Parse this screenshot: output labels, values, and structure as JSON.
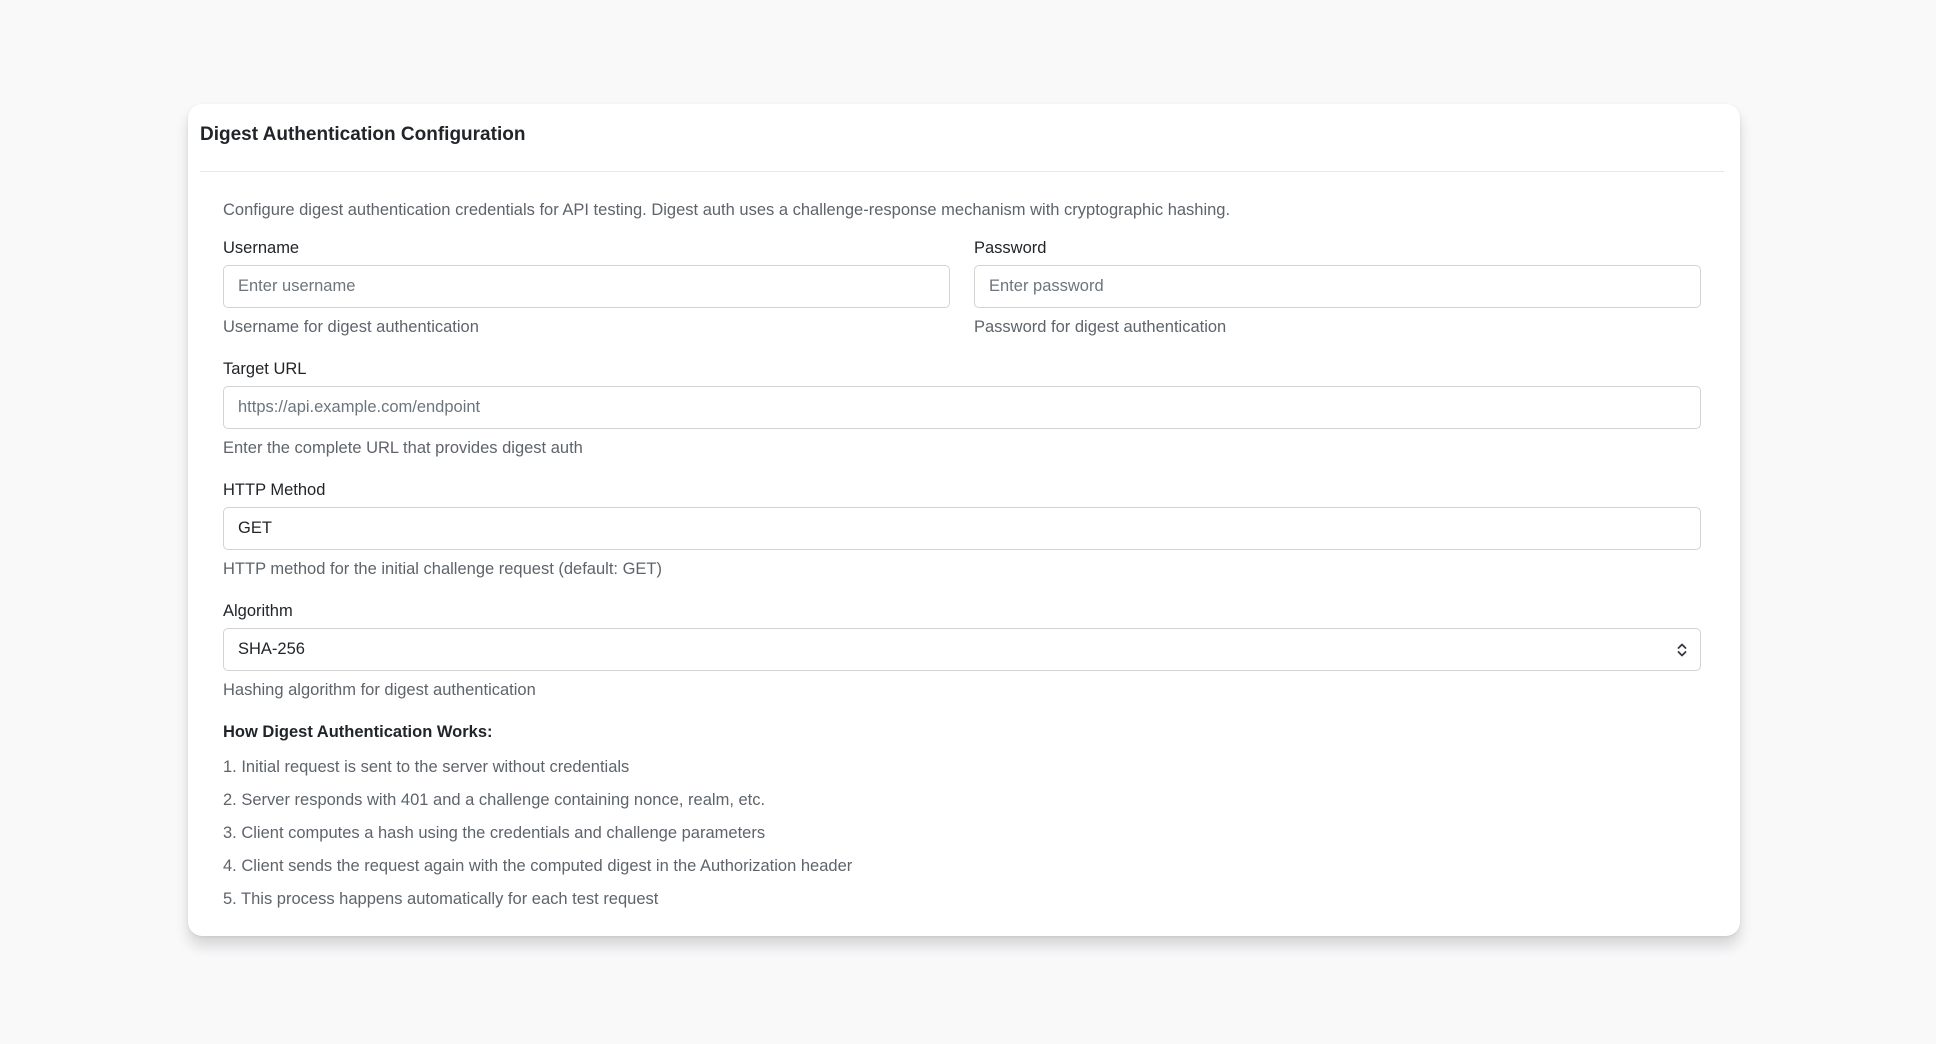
{
  "card": {
    "title": "Digest Authentication Configuration",
    "intro": "Configure digest authentication credentials for API testing. Digest auth uses a challenge-response mechanism with cryptographic hashing."
  },
  "username": {
    "label": "Username",
    "placeholder": "Enter username",
    "value": "",
    "help": "Username for digest authentication"
  },
  "password": {
    "label": "Password",
    "placeholder": "Enter password",
    "value": "",
    "help": "Password for digest authentication"
  },
  "target_url": {
    "label": "Target URL",
    "placeholder": "https://api.example.com/endpoint",
    "value": "",
    "help": "Enter the complete URL that provides digest auth"
  },
  "http_method": {
    "label": "HTTP Method",
    "value": "GET",
    "help": "HTTP method for the initial challenge request (default: GET)"
  },
  "algorithm": {
    "label": "Algorithm",
    "selected": "SHA-256",
    "help": "Hashing algorithm for digest authentication",
    "icon": "chevron-up-down-icon"
  },
  "how_it_works": {
    "title": "How Digest Authentication Works:",
    "steps": [
      "1. Initial request is sent to the server without credentials",
      "2. Server responds with 401 and a challenge containing nonce, realm, etc.",
      "3. Client computes a hash using the credentials and challenge parameters",
      "4. Client sends the request again with the computed digest in the Authorization header",
      "5. This process happens automatically for each test request"
    ]
  }
}
